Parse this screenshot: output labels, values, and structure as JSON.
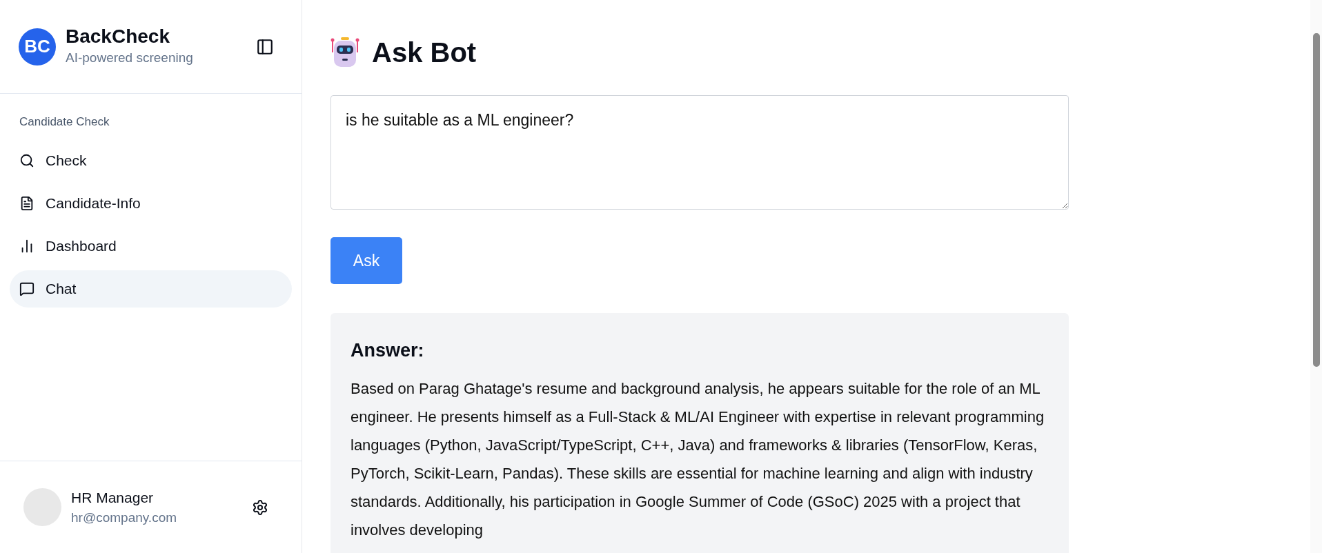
{
  "brand": {
    "initials": "BC",
    "name": "BackCheck",
    "tagline": "AI-powered screening"
  },
  "nav": {
    "section_label": "Candidate Check",
    "items": [
      {
        "label": "Check",
        "selected": false
      },
      {
        "label": "Candidate-Info",
        "selected": false
      },
      {
        "label": "Dashboard",
        "selected": false
      },
      {
        "label": "Chat",
        "selected": true
      }
    ]
  },
  "user": {
    "name": "HR Manager",
    "email": "hr@company.com"
  },
  "page": {
    "title": "Ask Bot"
  },
  "question": {
    "value": "is he suitable as a ML engineer?"
  },
  "ask_button": {
    "label": "Ask"
  },
  "answer": {
    "heading": "Answer:",
    "text": "Based on Parag Ghatage's resume and background analysis, he appears suitable for the role of an ML engineer. He presents himself as a Full-Stack & ML/AI Engineer with expertise in relevant programming languages (Python, JavaScript/TypeScript, C++, Java) and frameworks & libraries (TensorFlow, Keras, PyTorch, Scikit-Learn, Pandas). These skills are essential for machine learning and align with industry standards. Additionally, his participation in Google Summer of Code (GSoC) 2025 with a project that involves developing"
  }
}
